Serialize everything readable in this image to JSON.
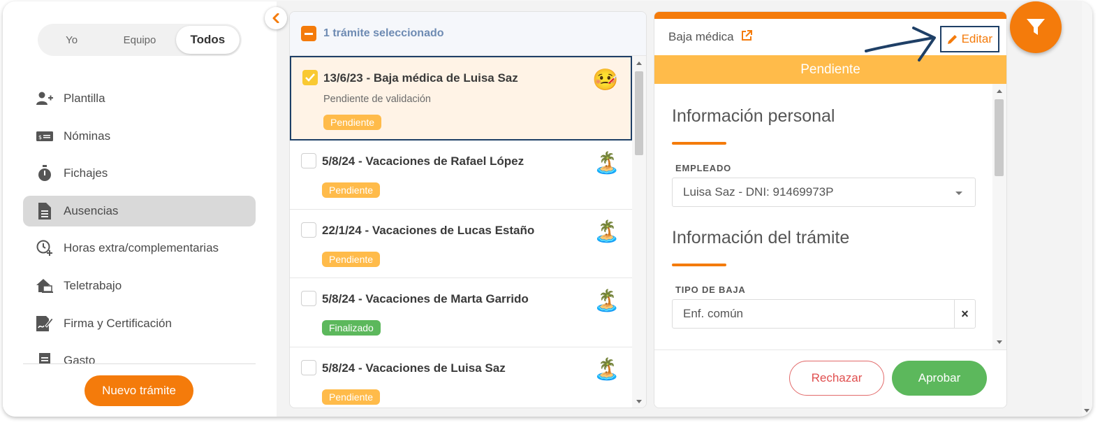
{
  "sidebar": {
    "scope_tabs": [
      {
        "label": "Yo",
        "active": false
      },
      {
        "label": "Equipo",
        "active": false
      },
      {
        "label": "Todos",
        "active": true
      }
    ],
    "items": [
      {
        "label": "Plantilla",
        "icon": "add-user-icon",
        "active": false
      },
      {
        "label": "Nóminas",
        "icon": "payslip-icon",
        "active": false
      },
      {
        "label": "Fichajes",
        "icon": "stopwatch-icon",
        "active": false
      },
      {
        "label": "Ausencias",
        "icon": "document-icon",
        "active": true
      },
      {
        "label": "Horas extra/complementarias",
        "icon": "clock-plus-icon",
        "active": false
      },
      {
        "label": "Teletrabajo",
        "icon": "home-laptop-icon",
        "active": false
      },
      {
        "label": "Firma y Certificación",
        "icon": "signature-icon",
        "active": false
      },
      {
        "label": "Gasto",
        "icon": "receipt-icon",
        "active": false
      }
    ],
    "new_button": "Nuevo trámite"
  },
  "list": {
    "header": "1 trámite seleccionado",
    "items": [
      {
        "title": "13/6/23 - Baja médica de Luisa Saz",
        "subtitle": "Pendiente de validación",
        "status": "Pendiente",
        "status_color": "#ffbb4a",
        "emoji": "🤒",
        "selected": true
      },
      {
        "title": "5/8/24 - Vacaciones de Rafael López",
        "subtitle": "",
        "status": "Pendiente",
        "status_color": "#ffbb4a",
        "emoji": "🏝️",
        "selected": false
      },
      {
        "title": "22/1/24 - Vacaciones de Lucas Estaño",
        "subtitle": "",
        "status": "Pendiente",
        "status_color": "#ffbb4a",
        "emoji": "🏝️",
        "selected": false
      },
      {
        "title": "5/8/24 - Vacaciones de Marta Garrido",
        "subtitle": "",
        "status": "Finalizado",
        "status_color": "#5cb85c",
        "emoji": "🏝️",
        "selected": false
      },
      {
        "title": "5/8/24 - Vacaciones de Luisa Saz",
        "subtitle": "",
        "status": "Pendiente",
        "status_color": "#ffbb4a",
        "emoji": "🏝️",
        "selected": false
      }
    ]
  },
  "detail": {
    "type": "Baja médica",
    "edit_label": "Editar",
    "status": "Pendiente",
    "section_personal": "Información personal",
    "employee_label": "EMPLEADO",
    "employee_value": "Luisa Saz - DNI: 91469973P",
    "section_procedure": "Información del trámite",
    "leave_type_label": "TIPO DE BAJA",
    "leave_type_value": "Enf. común",
    "clear_symbol": "×",
    "reject_label": "Rechazar",
    "approve_label": "Aprobar"
  },
  "colors": {
    "accent": "#f47b0b",
    "pending": "#ffbb4a",
    "finished": "#5cb85c",
    "highlight_border": "#1e3f66"
  }
}
